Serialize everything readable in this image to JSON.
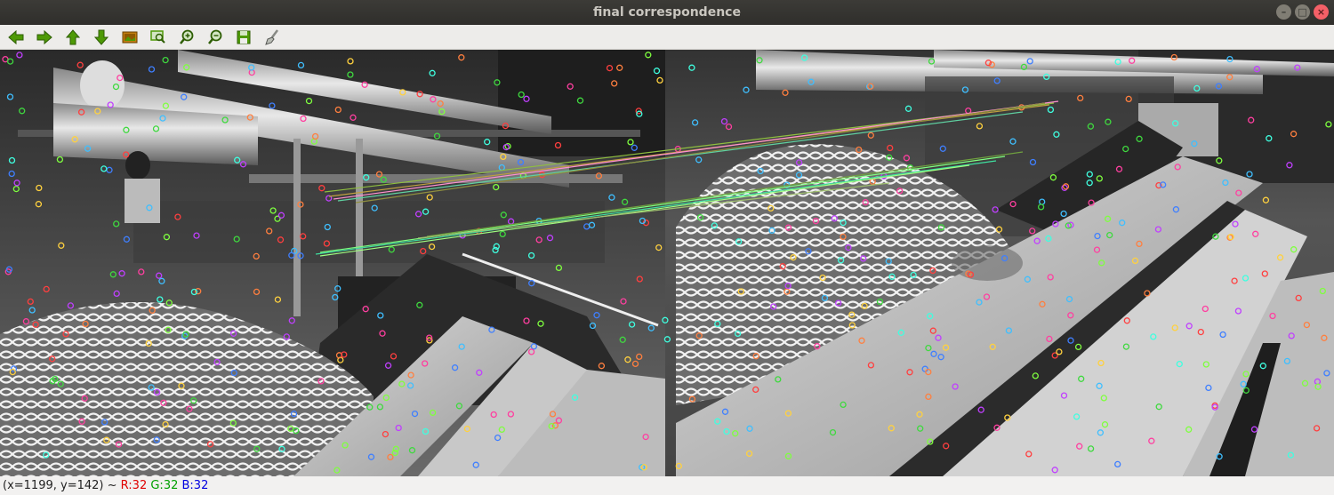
{
  "window": {
    "title": "final correspondence"
  },
  "window_controls": [
    {
      "name": "minimize",
      "glyph": "–"
    },
    {
      "name": "maximize",
      "glyph": "□"
    },
    {
      "name": "close",
      "glyph": "×"
    }
  ],
  "toolbar": {
    "buttons": [
      {
        "name": "pan-left",
        "icon": "arrow-left-icon",
        "color": "#4e9a06"
      },
      {
        "name": "pan-right",
        "icon": "arrow-right-icon",
        "color": "#4e9a06"
      },
      {
        "name": "pan-up",
        "icon": "arrow-up-icon",
        "color": "#4e9a06"
      },
      {
        "name": "pan-down",
        "icon": "arrow-down-icon",
        "color": "#4e9a06"
      },
      {
        "name": "zoom-fit",
        "icon": "image-icon",
        "color": "#8f5902"
      },
      {
        "name": "zoom-area",
        "icon": "zoom-rect-icon",
        "color": "#4e9a06"
      },
      {
        "name": "zoom-in",
        "icon": "zoom-in-icon",
        "color": "#4e9a06"
      },
      {
        "name": "zoom-out",
        "icon": "zoom-out-icon",
        "color": "#4e9a06"
      },
      {
        "name": "save",
        "icon": "save-icon",
        "color": "#4e9a06"
      },
      {
        "name": "properties",
        "icon": "brush-icon",
        "color": "#888a85"
      }
    ]
  },
  "status": {
    "coords": "(x=1199, y=142) ~",
    "r": "R:32",
    "g": "G:32",
    "b": "B:32"
  },
  "colors": {
    "titlebar": "#3c3b37",
    "toolbar_bg": "#edecea",
    "icon_green": "#4e9a06"
  }
}
